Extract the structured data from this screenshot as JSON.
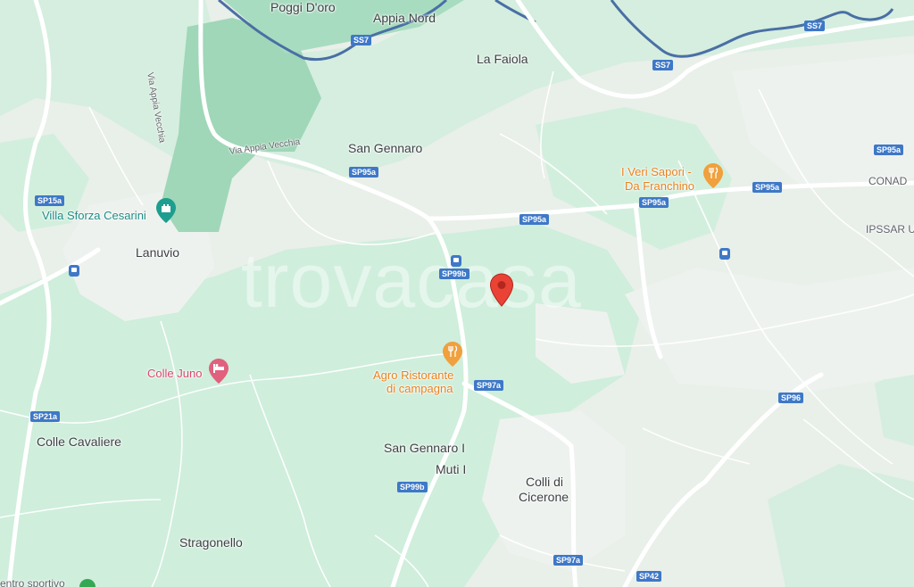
{
  "watermark": "trovacasa",
  "places": {
    "poggi_doro": "Poggi D'oro",
    "appia_nord": "Appia Nord",
    "la_faiola": "La Faiola",
    "san_gennaro": "San Gennaro",
    "lanuvio": "Lanuvio",
    "colle_cavaliere": "Colle Cavaliere",
    "san_gennaro_i": "San Gennaro I",
    "muti_i": "Muti I",
    "colli_di_cicerone_1": "Colli di",
    "colli_di_cicerone_2": "Cicerone",
    "stragonello": "Stragonello",
    "conad": "CONAD",
    "ipssar": "IPSSAR U",
    "centro_sportivo": "entro sportivo"
  },
  "pois": {
    "veri_sapori_1": "I Veri Sapori -",
    "veri_sapori_2": "Da Franchino",
    "agro_1": "Agro Ristorante",
    "agro_2": "di campagna",
    "colle_juno": "Colle Juno",
    "villa_sforza": "Villa Sforza Cesarini"
  },
  "streets": {
    "via_appia_vecchia_1": "Via Appia Vecchia",
    "via_appia_vecchia_2": "Via Appia Vecchia"
  },
  "shields": {
    "ss7_a": "SS7",
    "ss7_b": "SS7",
    "ss7_c": "SS7",
    "sp95a_a": "SP95a",
    "sp95a_b": "SP95a",
    "sp95a_c": "SP95a",
    "sp95a_d": "SP95a",
    "sp95a_e": "SP95a",
    "sp15a": "SP15a",
    "sp99b_a": "SP99b",
    "sp99b_b": "SP99b",
    "sp97a_a": "SP97a",
    "sp97a_b": "SP97a",
    "sp21a": "SP21a",
    "sp96": "SP96",
    "sp42": "SP42"
  },
  "colors": {
    "water": "#4a6fa5",
    "land": "#e9efe9",
    "green": "#cdeedd",
    "park": "#a8dcc0",
    "shield": "#3e78c7",
    "pin": "#ea4335",
    "restaurant": "#f0a03c",
    "hotel": "#e0607e",
    "attraction": "#1e9e8f"
  }
}
